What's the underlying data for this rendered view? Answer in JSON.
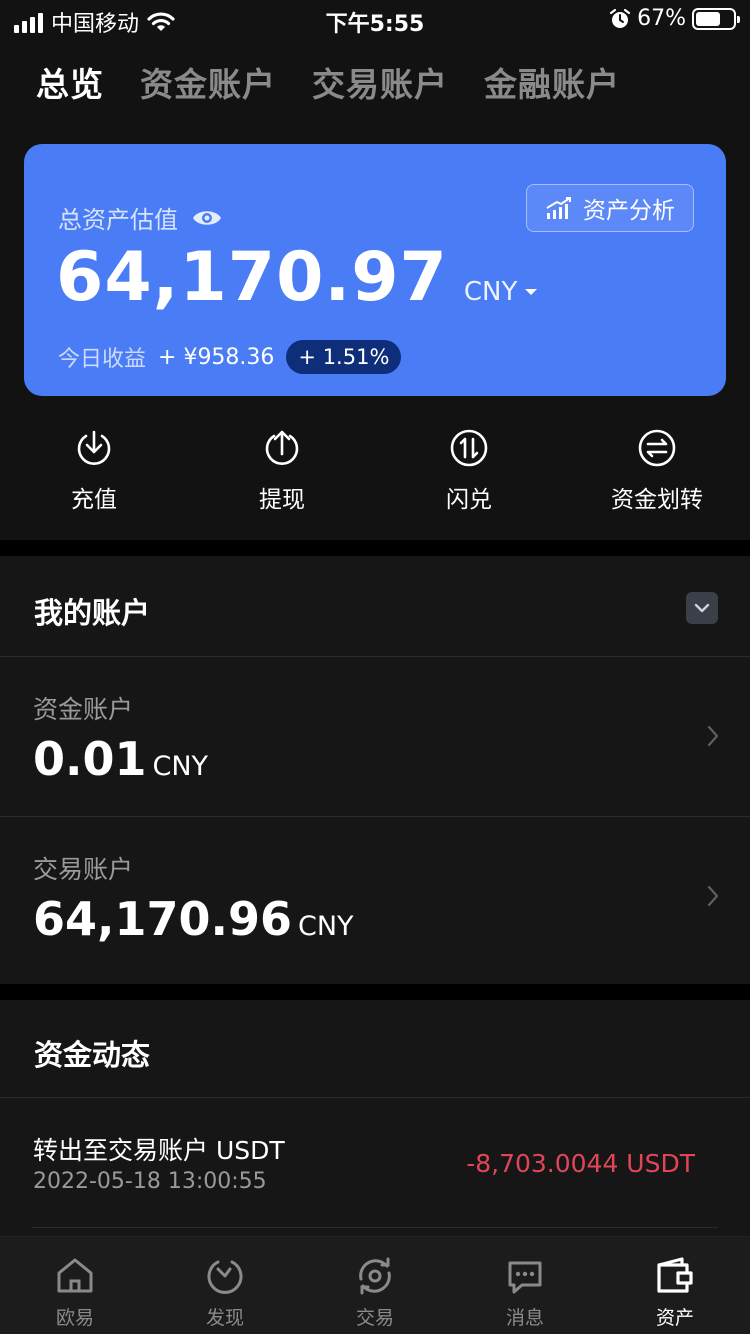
{
  "status_bar": {
    "carrier": "中国移动",
    "time": "下午5:55",
    "battery_text": "67%",
    "battery_level": 0.67
  },
  "tabs": [
    {
      "label": "总览",
      "active": true
    },
    {
      "label": "资金账户",
      "active": false
    },
    {
      "label": "交易账户",
      "active": false
    },
    {
      "label": "金融账户",
      "active": false
    }
  ],
  "asset_card": {
    "label": "总资产估值",
    "analysis_button": "资产分析",
    "amount": "64,170.97",
    "unit": "CNY",
    "income_label": "今日收益",
    "income_value": "+ ¥958.36",
    "income_percent": "+ 1.51%",
    "card_color": "#4a7cf6"
  },
  "quick_actions": [
    {
      "label": "充值",
      "icon": "deposit-icon"
    },
    {
      "label": "提现",
      "icon": "withdraw-icon"
    },
    {
      "label": "闪兑",
      "icon": "swap-icon"
    },
    {
      "label": "资金划转",
      "icon": "transfer-icon"
    }
  ],
  "my_accounts": {
    "title": "我的账户",
    "items": [
      {
        "label": "资金账户",
        "value": "0.01",
        "unit": "CNY"
      },
      {
        "label": "交易账户",
        "value": "64,170.96",
        "unit": "CNY"
      }
    ]
  },
  "fund_flow": {
    "title": "资金动态",
    "items": [
      {
        "title": "转出至交易账户 USDT",
        "time": "2022-05-18 13:00:55",
        "amount": "-8,703.0044 USDT",
        "amount_color": "#e0455a"
      }
    ]
  },
  "bottom_nav": [
    {
      "label": "欧易",
      "icon": "home-icon",
      "active": false
    },
    {
      "label": "发现",
      "icon": "discover-icon",
      "active": false
    },
    {
      "label": "交易",
      "icon": "trade-icon",
      "active": false
    },
    {
      "label": "消息",
      "icon": "message-icon",
      "active": false
    },
    {
      "label": "资产",
      "icon": "wallet-icon",
      "active": true
    }
  ]
}
